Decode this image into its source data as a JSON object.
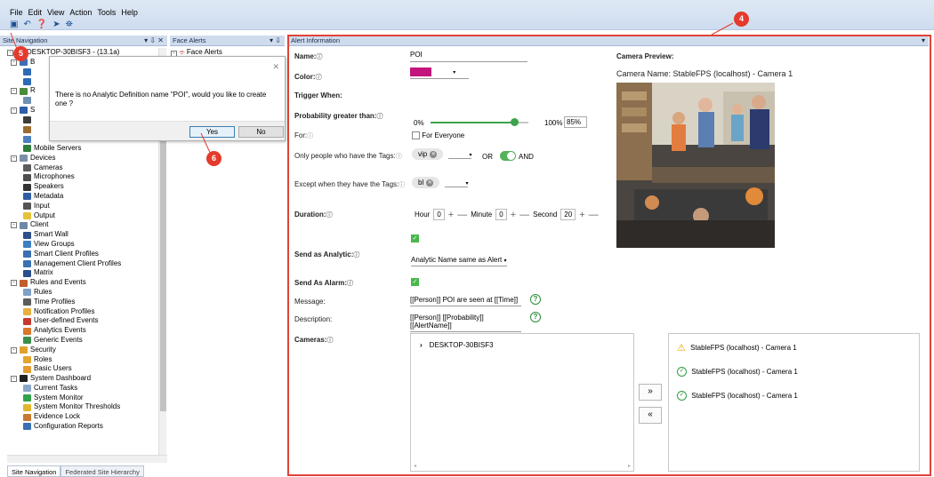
{
  "menu": [
    "File",
    "Edit",
    "View",
    "Action",
    "Tools",
    "Help"
  ],
  "toolbar_icons": [
    "save-icon",
    "undo-icon",
    "help-icon",
    "connect-icon",
    "binoculars-icon"
  ],
  "panels": {
    "site_nav": "Site Navigation",
    "face_alerts": "Face Alerts",
    "alert_info": "Alert Information",
    "controls": "▾ ⇩ ✕"
  },
  "face_alerts_item": "Face Alerts",
  "server": "DESKTOP-30BISF3 - (13.1a)",
  "tree": [
    {
      "depth": 1,
      "exp": "-",
      "label": "B",
      "icon": "#3d6fb4"
    },
    {
      "depth": 2,
      "exp": "",
      "label": "",
      "icon": "#2d6bb8"
    },
    {
      "depth": 2,
      "exp": "",
      "label": "",
      "icon": "#2d6bb8"
    },
    {
      "depth": 1,
      "exp": "-",
      "label": "R",
      "icon": "#4a8c3b"
    },
    {
      "depth": 2,
      "exp": "",
      "label": "",
      "icon": "#6f8fb3"
    },
    {
      "depth": 1,
      "exp": "-",
      "label": "S",
      "icon": "#2d5ea8"
    },
    {
      "depth": 2,
      "exp": "",
      "label": "",
      "icon": "#3c3c3c"
    },
    {
      "depth": 2,
      "exp": "",
      "label": "",
      "icon": "#9b6b30"
    },
    {
      "depth": 2,
      "exp": "",
      "label": "",
      "icon": "#4d7fbf"
    },
    {
      "depth": 2,
      "exp": "",
      "label": "Mobile Servers",
      "icon": "#2f7c3b"
    },
    {
      "depth": 1,
      "exp": "-",
      "label": "Devices",
      "icon": "#7d8fa8"
    },
    {
      "depth": 2,
      "exp": "",
      "label": "Cameras",
      "icon": "#5c5c5c"
    },
    {
      "depth": 2,
      "exp": "",
      "label": "Microphones",
      "icon": "#4f4f4f"
    },
    {
      "depth": 2,
      "exp": "",
      "label": "Speakers",
      "icon": "#333333"
    },
    {
      "depth": 2,
      "exp": "",
      "label": "Metadata",
      "icon": "#2f5ea5"
    },
    {
      "depth": 2,
      "exp": "",
      "label": "Input",
      "icon": "#555555"
    },
    {
      "depth": 2,
      "exp": "",
      "label": "Output",
      "icon": "#e4c23a"
    },
    {
      "depth": 1,
      "exp": "-",
      "label": "Client",
      "icon": "#6e87a8"
    },
    {
      "depth": 2,
      "exp": "",
      "label": "Smart Wall",
      "icon": "#2d4f8a"
    },
    {
      "depth": 2,
      "exp": "",
      "label": "View Groups",
      "icon": "#3d7fc1"
    },
    {
      "depth": 2,
      "exp": "",
      "label": "Smart Client Profiles",
      "icon": "#3a71b3"
    },
    {
      "depth": 2,
      "exp": "",
      "label": "Management Client Profiles",
      "icon": "#3a71b3"
    },
    {
      "depth": 2,
      "exp": "",
      "label": "Matrix",
      "icon": "#2b4f8c"
    },
    {
      "depth": 1,
      "exp": "-",
      "label": "Rules and Events",
      "icon": "#c25d2e"
    },
    {
      "depth": 2,
      "exp": "",
      "label": "Rules",
      "icon": "#7ea0c8"
    },
    {
      "depth": 2,
      "exp": "",
      "label": "Time Profiles",
      "icon": "#5c5c5c"
    },
    {
      "depth": 2,
      "exp": "",
      "label": "Notification Profiles",
      "icon": "#e8b040"
    },
    {
      "depth": 2,
      "exp": "",
      "label": "User-defined Events",
      "icon": "#c7392f"
    },
    {
      "depth": 2,
      "exp": "",
      "label": "Analytics Events",
      "icon": "#d9772b"
    },
    {
      "depth": 2,
      "exp": "",
      "label": "Generic Events",
      "icon": "#3c8e4c"
    },
    {
      "depth": 1,
      "exp": "-",
      "label": "Security",
      "icon": "#e0a22c"
    },
    {
      "depth": 2,
      "exp": "",
      "label": "Roles",
      "icon": "#e3a52d"
    },
    {
      "depth": 2,
      "exp": "",
      "label": "Basic Users",
      "icon": "#e39b30"
    },
    {
      "depth": 1,
      "exp": "-",
      "label": "System Dashboard",
      "icon": "#222222"
    },
    {
      "depth": 2,
      "exp": "",
      "label": "Current Tasks",
      "icon": "#8aa6c9"
    },
    {
      "depth": 2,
      "exp": "",
      "label": "System Monitor",
      "icon": "#31a34a"
    },
    {
      "depth": 2,
      "exp": "",
      "label": "System Monitor Thresholds",
      "icon": "#e3b52d"
    },
    {
      "depth": 2,
      "exp": "",
      "label": "Evidence Lock",
      "icon": "#c97a2f"
    },
    {
      "depth": 2,
      "exp": "",
      "label": "Configuration Reports",
      "icon": "#3a6fb4"
    }
  ],
  "bottom_tabs": [
    "Site Navigation",
    "Federated Site Hierarchy"
  ],
  "dialog": {
    "message": "There is no Analytic Definition name \"POI\", would you like to create one ?",
    "yes": "Yes",
    "no": "No",
    "close": "✕"
  },
  "badges": {
    "b4": "4",
    "b5": "5",
    "b6": "6"
  },
  "form": {
    "name_label": "Name:",
    "name_value": "POI",
    "color_label": "Color:",
    "color_value": "#c4157d",
    "trigger_label": "Trigger When:",
    "prob_label": "Probability greater than:",
    "prob_min": "0%",
    "prob_max": "100%",
    "prob_value": "85%",
    "prob_fraction": 0.85,
    "for_label": "For:",
    "for_everyone": "For Everyone",
    "only_label": "Only people who have the Tags:",
    "only_tag": "vip",
    "or": "OR",
    "and": "AND",
    "except_label": "Except when they have the Tags:",
    "except_tag": "bl",
    "duration_label": "Duration:",
    "hour": "Hour",
    "hour_val": "0",
    "minute": "Minute",
    "minute_val": "0",
    "second": "Second",
    "second_val": "20",
    "send_analytic_label": "Send as Analytic:",
    "analytic_select": "Analytic Name same as Alert",
    "send_alarm_label": "Send As Alarm:",
    "message_label": "Message:",
    "message_value": "[[Person]] POI are seen at [[Time]]",
    "description_label": "Description:",
    "description_value": "[[Person]] [[Probability]][[AlertName]]",
    "cameras_label": "Cameras:",
    "qmark": "?"
  },
  "preview": {
    "title": "Camera Preview:",
    "camera_name": "Camera Name:  StableFPS (localhost) - Camera 1"
  },
  "cameras_tree": "DESKTOP-30BISF3",
  "arrows": {
    "add": "»",
    "remove": "«"
  },
  "selected_cameras": [
    {
      "label": "StableFPS (localhost) - Camera 1",
      "status": "warning"
    },
    {
      "label": "StableFPS (localhost) - Camera 1",
      "status": "ok"
    },
    {
      "label": "StableFPS (localhost) - Camera 1",
      "status": "ok"
    }
  ]
}
